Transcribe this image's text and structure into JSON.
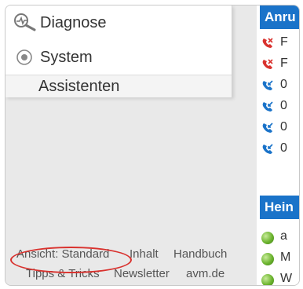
{
  "menu": {
    "items": [
      {
        "label": "Diagnose",
        "icon": "diagnose-icon"
      },
      {
        "label": "System",
        "icon": "system-icon"
      },
      {
        "label": "Assistenten"
      }
    ]
  },
  "footer": {
    "view_label": "Ansicht: Standard",
    "links": [
      "Inhalt",
      "Handbuch",
      "Tipps & Tricks",
      "Newsletter",
      "avm.de"
    ]
  },
  "right_panel": {
    "calls_header": "Anru",
    "calls": [
      {
        "text": "F",
        "icon": "missed-call-icon",
        "color": "#d9322e"
      },
      {
        "text": "F",
        "icon": "missed-call-icon",
        "color": "#d9322e"
      },
      {
        "text": "0",
        "icon": "incoming-call-icon",
        "color": "#1a73c9"
      },
      {
        "text": "0",
        "icon": "incoming-call-icon",
        "color": "#1a73c9"
      },
      {
        "text": "0",
        "icon": "incoming-call-icon",
        "color": "#1a73c9"
      },
      {
        "text": "0",
        "icon": "incoming-call-icon",
        "color": "#1a73c9"
      }
    ],
    "home_header": "Hein",
    "devices": [
      {
        "text": "a",
        "icon": "online-status-icon"
      },
      {
        "text": "M",
        "icon": "online-status-icon"
      },
      {
        "text": "W",
        "icon": "online-status-icon"
      }
    ]
  },
  "colors": {
    "accent": "#1a73c9",
    "highlight": "#d9322e"
  }
}
